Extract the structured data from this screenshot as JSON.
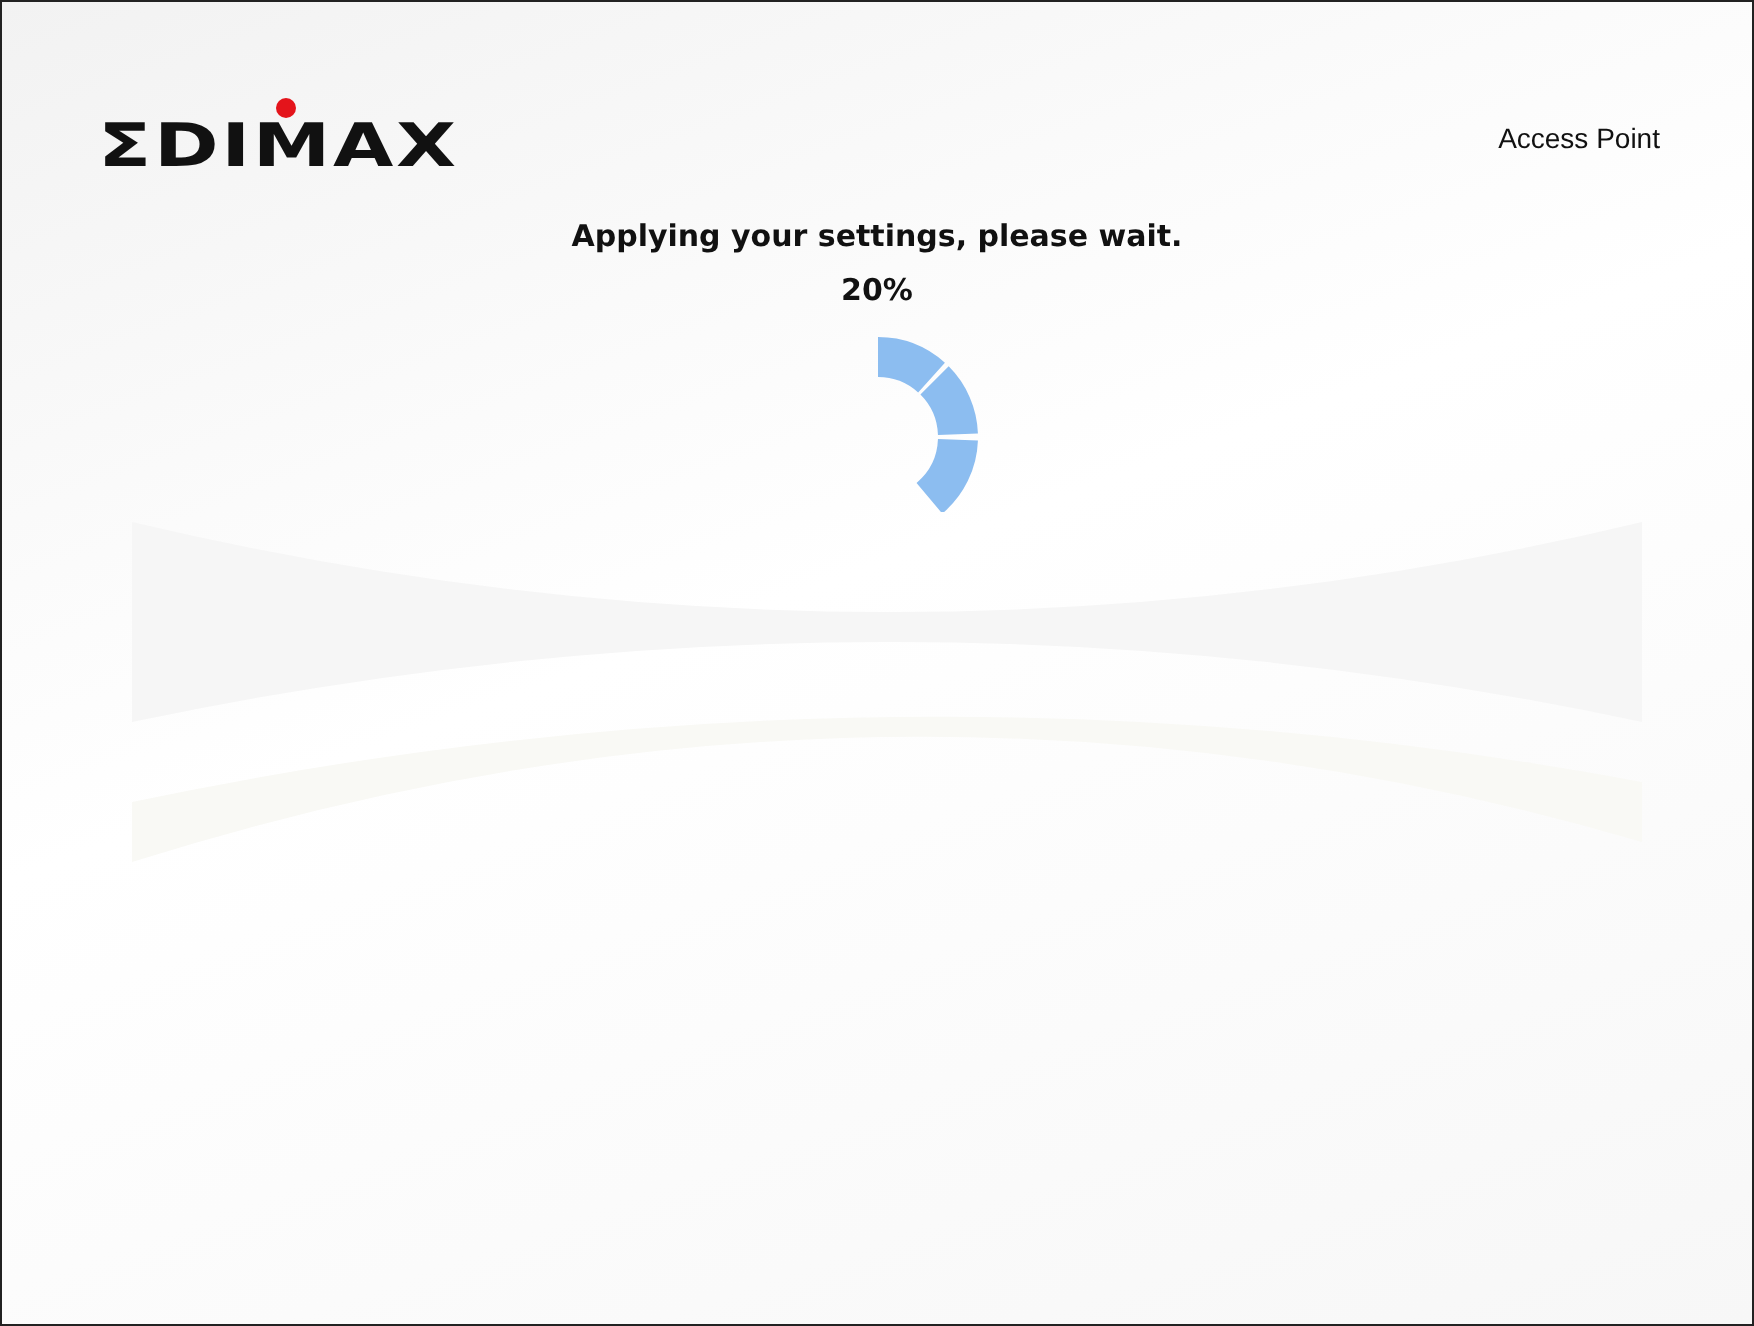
{
  "header": {
    "logo": "ΣDIMAX",
    "product": "Access Point"
  },
  "status": {
    "message": "Applying your settings, please wait.",
    "percent": "20%"
  }
}
